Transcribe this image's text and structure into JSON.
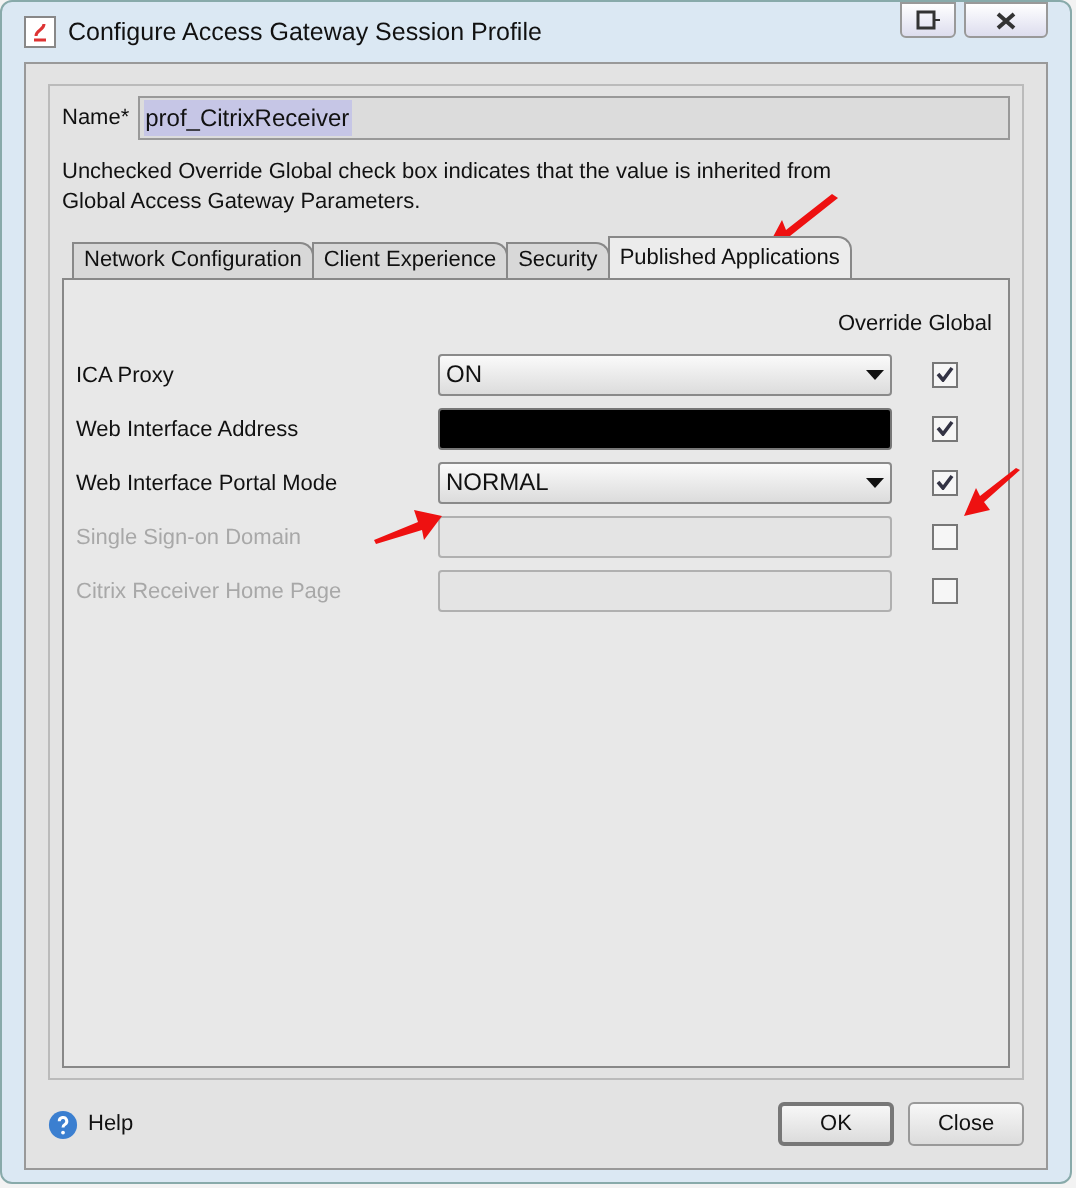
{
  "window": {
    "title": "Configure Access Gateway Session Profile"
  },
  "name_field": {
    "label": "Name*",
    "value": "prof_CitrixReceiver"
  },
  "note": "Unchecked Override Global check box indicates that the value is inherited from Global Access Gateway Parameters.",
  "tabs": [
    {
      "label": "Network Configuration",
      "selected": false
    },
    {
      "label": "Client Experience",
      "selected": false
    },
    {
      "label": "Security",
      "selected": false
    },
    {
      "label": "Published Applications",
      "selected": true
    }
  ],
  "override_header": "Override Global",
  "settings": [
    {
      "label": "ICA Proxy",
      "kind": "dropdown",
      "value": "ON",
      "disabled": false,
      "checked": true
    },
    {
      "label": "Web Interface Address",
      "kind": "redacted",
      "disabled": false,
      "checked": true
    },
    {
      "label": "Web Interface Portal Mode",
      "kind": "dropdown",
      "value": "NORMAL",
      "disabled": false,
      "checked": true
    },
    {
      "label": "Single Sign-on Domain",
      "kind": "text",
      "disabled": true,
      "checked": false
    },
    {
      "label": "Citrix Receiver Home Page",
      "kind": "text",
      "disabled": true,
      "checked": false
    }
  ],
  "help": "Help",
  "buttons": [
    {
      "label": "OK",
      "kind": "default"
    },
    {
      "label": "Close",
      "kind": "normal"
    }
  ]
}
